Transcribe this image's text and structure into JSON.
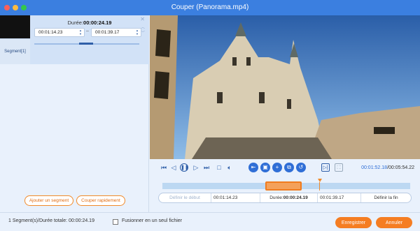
{
  "window": {
    "title": "Couper (Panorama.mp4)"
  },
  "segment": {
    "tab_label": "Segment[1]",
    "duration_label": "Durée:",
    "duration_value": "00:00:24.19",
    "start": "00:01:14.23",
    "separator": "–",
    "end": "00:01:39.17"
  },
  "left_buttons": {
    "add_segment": "Ajouter un segment",
    "quick_cut": "Couper rapidement"
  },
  "player": {
    "current_time": "00:01:52.18",
    "total_time": "/00:05:54.22"
  },
  "trim": {
    "set_start": "Définir le début",
    "start": "00:01:14.23",
    "duration_label": "Durée:",
    "duration_value": "00:00:24.19",
    "end": "00:01:39.17",
    "set_end": "Définir la fin"
  },
  "footer": {
    "summary": "1 Segment(s)/Durée totale: 00:00:24.19",
    "merge_label": "Fusionner en un seul fichier",
    "save": "Enregistrer",
    "cancel": "Annuler"
  },
  "colors": {
    "accent": "#3b7fe0",
    "orange": "#f57d22"
  }
}
